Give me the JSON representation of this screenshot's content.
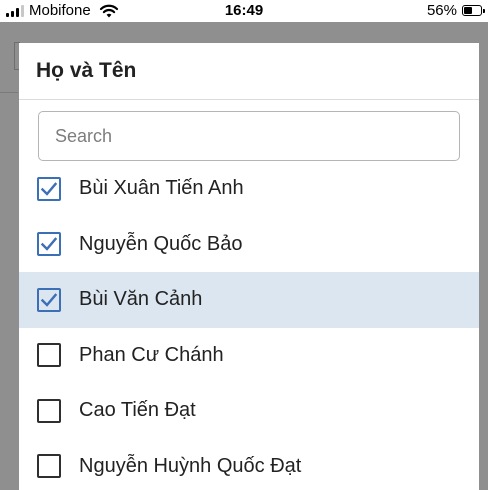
{
  "status_bar": {
    "carrier": "Mobifone",
    "time": "16:49",
    "battery_percent": "56%",
    "battery_level": 0.56,
    "signal_icon": "cellular-signal-icon",
    "wifi_icon": "wifi-icon",
    "battery_icon": "battery-icon"
  },
  "modal": {
    "title": "Họ và Tên",
    "search": {
      "placeholder": "Search",
      "value": ""
    },
    "items": [
      {
        "label": "Bùi Xuân Tiến Anh",
        "checked": true,
        "highlighted": false
      },
      {
        "label": "Nguyễn Quốc Bảo",
        "checked": true,
        "highlighted": false
      },
      {
        "label": "Bùi Văn Cảnh",
        "checked": true,
        "highlighted": true
      },
      {
        "label": "Phan Cư Chánh",
        "checked": false,
        "highlighted": false
      },
      {
        "label": "Cao Tiến Đạt",
        "checked": false,
        "highlighted": false
      },
      {
        "label": "Nguyễn Huỳnh Quốc Đạt",
        "checked": false,
        "highlighted": false
      }
    ]
  },
  "colors": {
    "checkbox_checked": "#3b6fb6",
    "row_highlight": "#dce6f1",
    "backdrop": "#8f8f8f"
  }
}
